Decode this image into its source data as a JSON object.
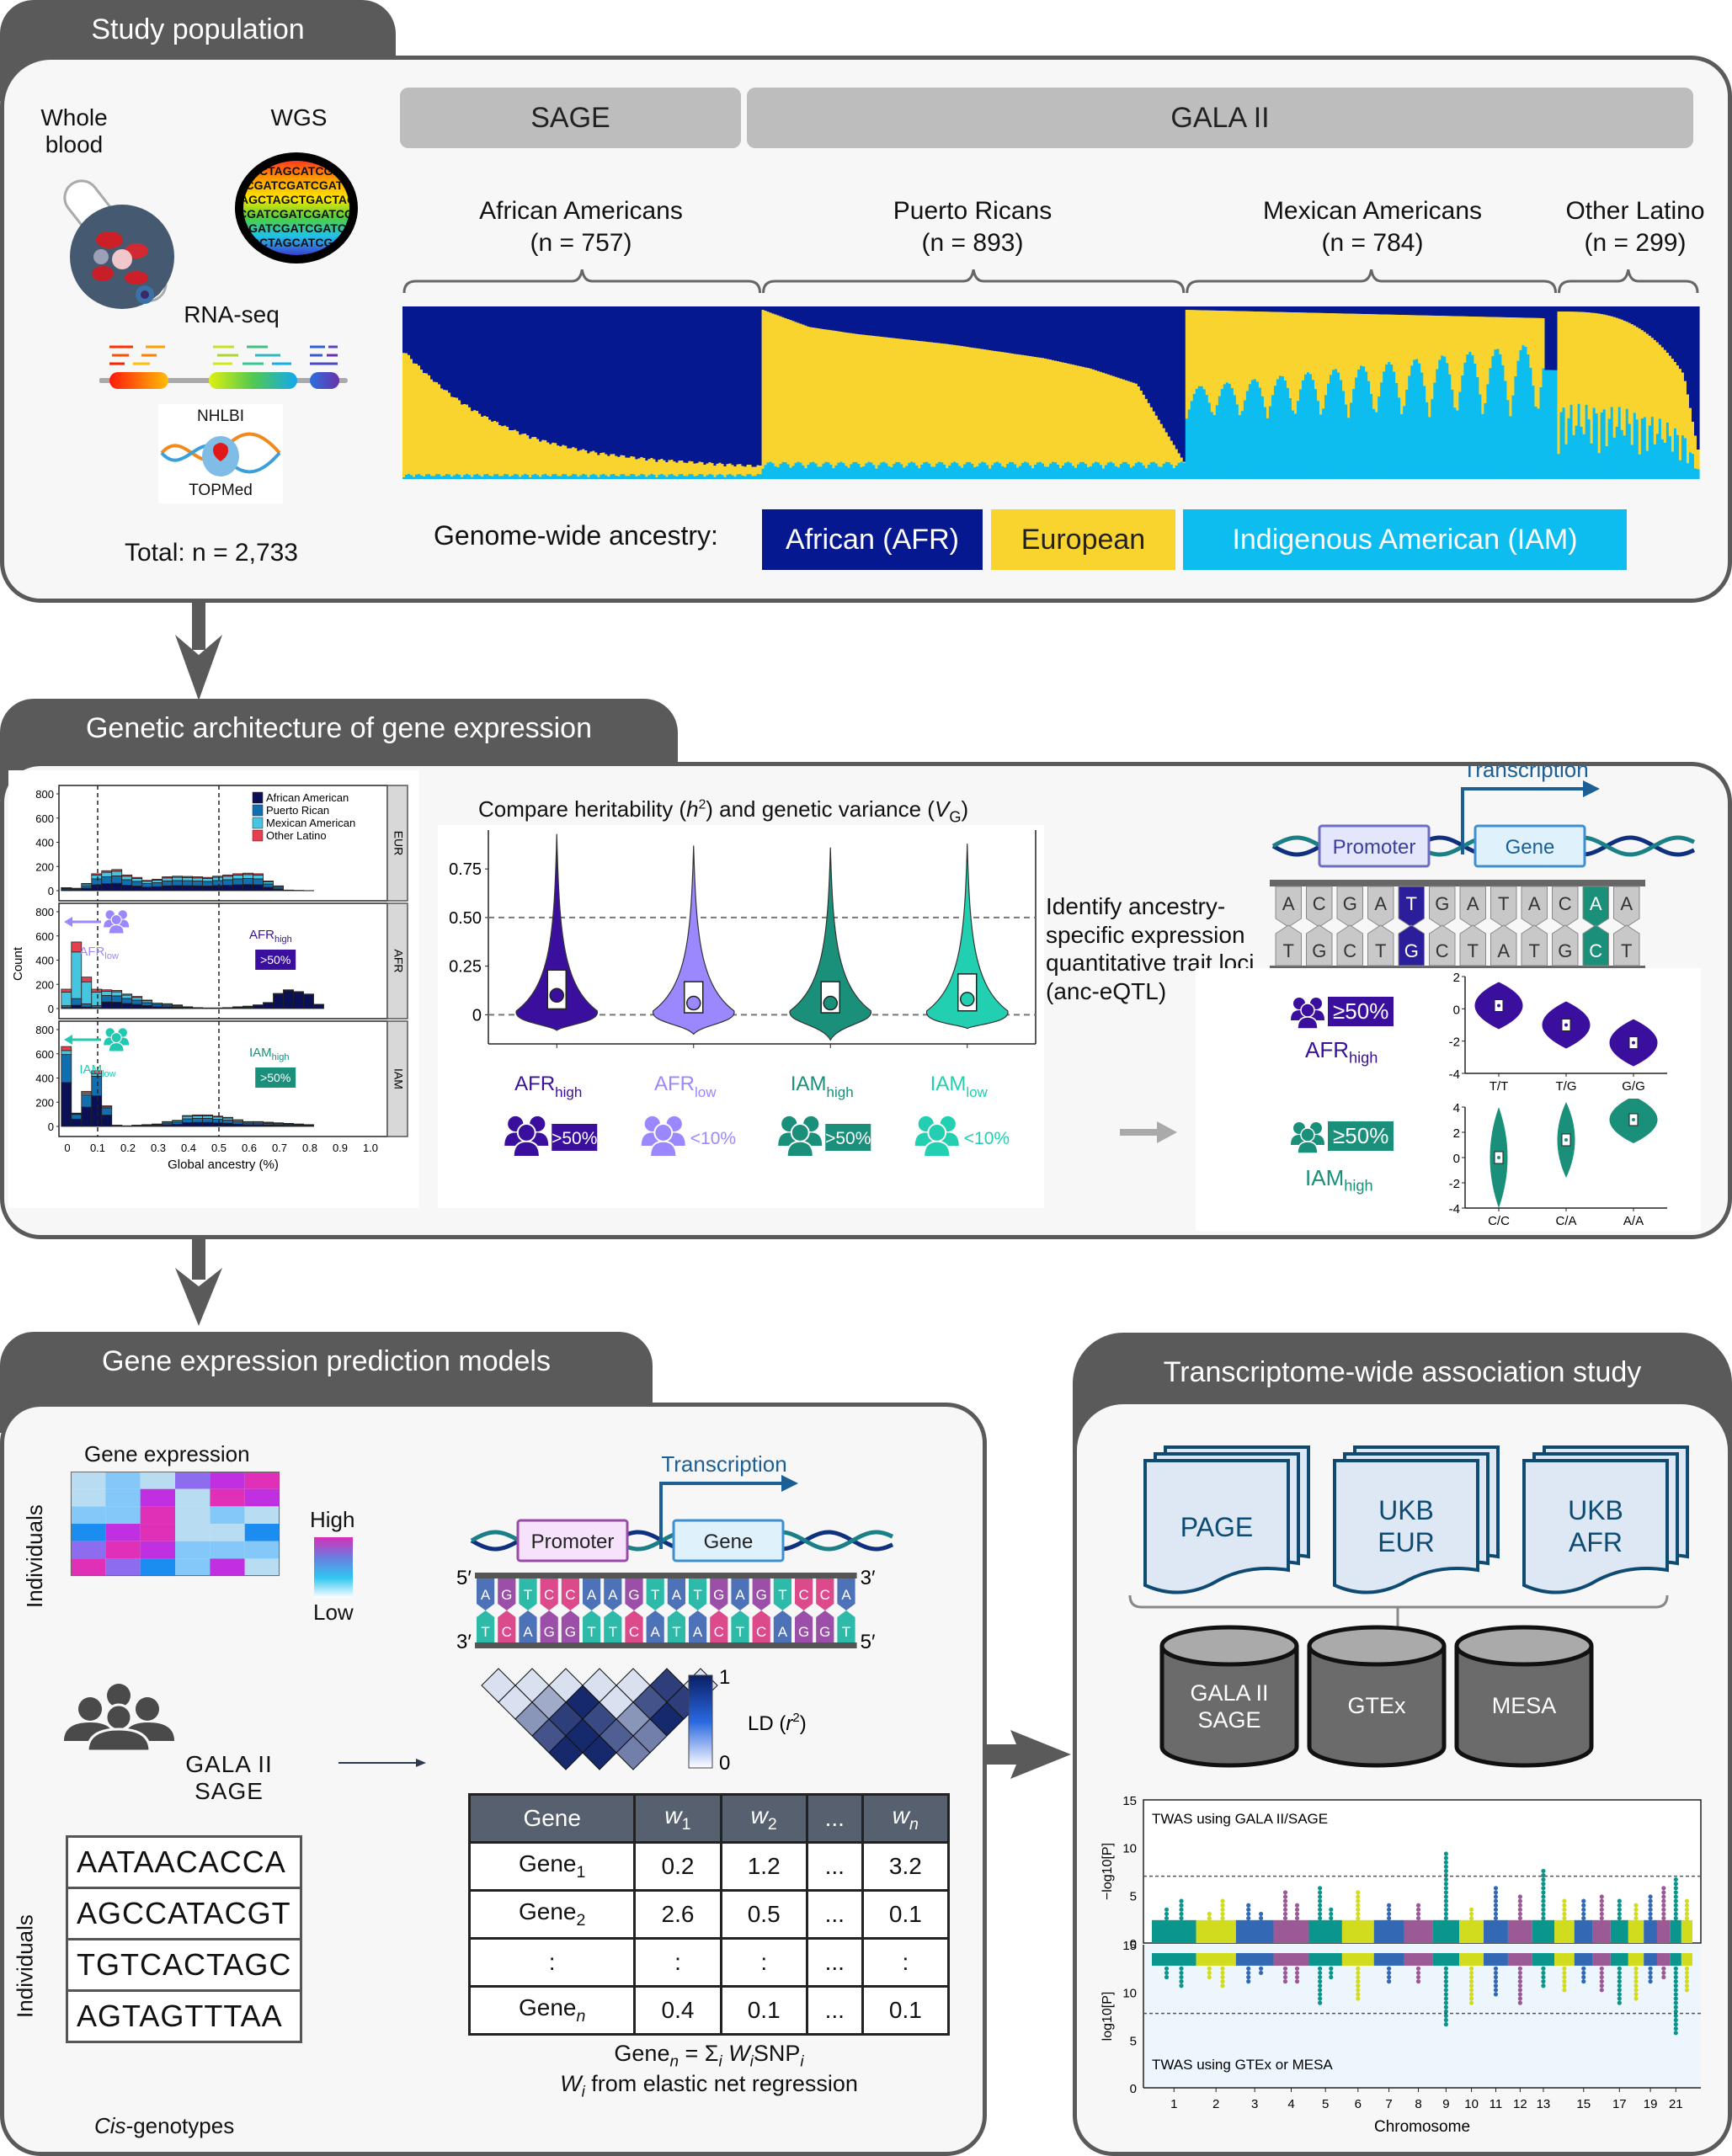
{
  "sections": {
    "study_population": {
      "title": "Study population",
      "whole_blood_label": "Whole\nblood",
      "wgs_label": "WGS",
      "rnaseq_label": "RNA-seq",
      "topmed_top": "NHLBI",
      "topmed_bottom": "TOPMed",
      "total_label": "Total: ",
      "total_n": "n = 2,733",
      "cohorts": [
        {
          "name": "SAGE"
        },
        {
          "name": "GALA II"
        }
      ],
      "groups": [
        {
          "name": "African Americans",
          "n_label": "(n = 757)",
          "n": 757
        },
        {
          "name": "Puerto Ricans",
          "n_label": "(n = 893)",
          "n": 893
        },
        {
          "name": "Mexican Americans",
          "n_label": "(n = 784)",
          "n": 784
        },
        {
          "name": "Other Latino",
          "n_label": "(n = 299)",
          "n": 299
        }
      ],
      "ancestry_legend_label": "Genome-wide ancestry:",
      "ancestry_legend": [
        {
          "label": "African (AFR)",
          "color": "#06188f",
          "text_color": "#ffffff"
        },
        {
          "label": "European",
          "color": "#f9d42f",
          "text_color": "#222222"
        },
        {
          "label": "Indigenous American (IAM)",
          "color": "#0dbdf0",
          "text_color": "#ffffff"
        }
      ]
    },
    "genetic_architecture": {
      "title": "Genetic architecture of gene expression",
      "heritability_title": "Compare heritability (h²) and genetic variance (V_G)",
      "eqtl_text": "Identify ancestry-specific expression quantitative trait loci (anc-eQTL)",
      "transcription_label": "Transcription",
      "promoter_label": "Promoter",
      "gene_label": "Gene",
      "dna_top": [
        "A",
        "C",
        "G",
        "A",
        "T",
        "G",
        "A",
        "T",
        "A",
        "C",
        "A",
        "A"
      ],
      "dna_bottom": [
        "T",
        "G",
        "C",
        "T",
        "G",
        "C",
        "T",
        "A",
        "T",
        "G",
        "C",
        "T"
      ],
      "afr_badge": "≥50%",
      "iam_badge": "≥50%",
      "afr_high_label": "AFR",
      "afr_high_sub": "high",
      "iam_high_label": "IAM",
      "iam_high_sub": "high"
    },
    "prediction_models": {
      "title": "Gene expression prediction models",
      "heatmap_title": "Gene expression",
      "individuals_label": "Individuals",
      "high_label": "High",
      "low_label": "Low",
      "cohort_label_1": "GALA II",
      "cohort_label_2": "SAGE",
      "genotypes": [
        "AATAACACCA",
        "AGCCATACGT",
        "TGTCACTAGC",
        "AGTAGTTTAA"
      ],
      "genotypes_caption_italic": "Cis",
      "genotypes_caption_rest": "-genotypes",
      "transcription_label": "Transcription",
      "promoter_label": "Promoter",
      "gene_label": "Gene",
      "five_prime": "5′",
      "three_prime": "3′",
      "dna_top": [
        "A",
        "G",
        "T",
        "C",
        "C",
        "A",
        "A",
        "G",
        "T",
        "A",
        "T",
        "G",
        "A",
        "G",
        "T",
        "C",
        "C",
        "A"
      ],
      "dna_bottom": [
        "T",
        "C",
        "A",
        "G",
        "G",
        "T",
        "T",
        "C",
        "A",
        "T",
        "A",
        "C",
        "T",
        "C",
        "A",
        "G",
        "G",
        "T"
      ],
      "ld_label": "LD (r²)",
      "ld_max": "1",
      "ld_min": "0",
      "weights_table": {
        "headers": [
          "Gene",
          "w1",
          "w2",
          "...",
          "wn"
        ],
        "rows": [
          [
            "Gene1",
            "0.2",
            "1.2",
            "...",
            "3.2"
          ],
          [
            "Gene2",
            "2.6",
            "0.5",
            "...",
            "0.1"
          ],
          [
            ":",
            ":",
            ":",
            "...",
            ":"
          ],
          [
            "Genen",
            "0.4",
            "0.1",
            "...",
            "0.1"
          ]
        ]
      },
      "formula_line1": "Gene_n = Σ_i W_i SNP_i",
      "formula_line2": "W_i from elastic net regression"
    },
    "twas": {
      "title": "Transcriptome-wide association study",
      "gwas_sources": [
        "PAGE",
        "UKB\nEUR",
        "UKB\nAFR"
      ],
      "models": [
        "GALA II\nSAGE",
        "GTEx",
        "MESA"
      ],
      "top_panel_label": "TWAS using GALA II/SAGE",
      "bottom_panel_label": "TWAS using GTEx or MESA",
      "top_ylabel": "−log10[P]",
      "bottom_ylabel": "log10[P]",
      "xlabel": "Chromosome"
    }
  },
  "chart_data": [
    {
      "id": "ancestry-stacked-bars",
      "type": "bar",
      "title": "Genome-wide ancestry",
      "stacked": true,
      "series_order": [
        "Indigenous American (IAM)",
        "European",
        "African (AFR)"
      ],
      "groups": [
        {
          "name": "African Americans",
          "n": 757,
          "afr_sorted_profile": [
            0.55,
            0.72,
            0.78,
            0.82,
            0.84,
            0.86,
            0.88,
            0.9,
            0.93,
            0.99
          ],
          "iam_mean": 0.01
        },
        {
          "name": "Puerto Ricans",
          "n": 893,
          "afr_sorted_profile": [
            0.02,
            0.12,
            0.16,
            0.19,
            0.22,
            0.26,
            0.3,
            0.36,
            0.45,
            0.9
          ],
          "iam_mean": 0.07
        },
        {
          "name": "Mexican Americans",
          "n": 784,
          "afr_sorted_profile": [
            0.0,
            0.01,
            0.02,
            0.03,
            0.03,
            0.04,
            0.04,
            0.05,
            0.06,
            0.1
          ],
          "iam_mean": 0.5
        },
        {
          "name": "Other Latino",
          "n": 299,
          "afr_sorted_profile": [
            0.01,
            0.05,
            0.1,
            0.16,
            0.22,
            0.3,
            0.4,
            0.5,
            0.62,
            0.8
          ],
          "iam_mean": 0.25
        }
      ],
      "ylim": [
        0,
        1
      ]
    },
    {
      "id": "global-ancestry-histograms",
      "type": "bar",
      "xlabel": "Global ancestry (%)",
      "ylabel": "Count",
      "x_ticks": [
        "0",
        "0.1",
        "0.2",
        "0.3",
        "0.4",
        "0.5",
        "0.6",
        "0.7",
        "0.8",
        "0.9",
        "1.0"
      ],
      "y_ticks": [
        "0",
        "200",
        "400",
        "600",
        "800"
      ],
      "ylim": [
        0,
        800
      ],
      "xlim": [
        0,
        1
      ],
      "reference_lines_x": [
        0.1,
        0.5
      ],
      "legend": [
        {
          "name": "African American",
          "color": "#0b0f55"
        },
        {
          "name": "Puerto Rican",
          "color": "#0f6fb0"
        },
        {
          "name": "Mexican American",
          "color": "#45c6e0"
        },
        {
          "name": "Other Latino",
          "color": "#e6404f"
        }
      ],
      "legend_position": "top-right",
      "bin_width": 0.0333,
      "facets": [
        {
          "label": "EUR",
          "totals": [
            25,
            20,
            60,
            140,
            165,
            175,
            130,
            110,
            85,
            95,
            115,
            120,
            118,
            115,
            110,
            120,
            130,
            140,
            145,
            140,
            80,
            40,
            5,
            2,
            1
          ],
          "annotations": []
        },
        {
          "label": "AFR",
          "totals": [
            160,
            550,
            260,
            160,
            155,
            150,
            120,
            100,
            70,
            45,
            40,
            30,
            15,
            8,
            5,
            5,
            8,
            15,
            20,
            30,
            50,
            125,
            155,
            140,
            120,
            35
          ],
          "annotations": [
            {
              "text": "AFR",
              "sub": "low",
              "color": "#9b88ff"
            },
            {
              "text": "AFR",
              "sub": "high",
              "color": "#3a0f9e",
              "badge": ">50%"
            }
          ]
        },
        {
          "label": "IAM",
          "totals": [
            660,
            110,
            290,
            460,
            170,
            10,
            5,
            10,
            15,
            20,
            40,
            50,
            90,
            95,
            95,
            85,
            75,
            55,
            40,
            40,
            35,
            30,
            25,
            20,
            15
          ],
          "annotations": [
            {
              "text": "IAM",
              "sub": "low",
              "color": "#22c9b0"
            },
            {
              "text": "IAM",
              "sub": "high",
              "color": "#1a8f7a",
              "badge": ">50%"
            }
          ]
        }
      ]
    },
    {
      "id": "heritability-violins",
      "type": "violin",
      "title": "Compare heritability (h²) and genetic variance (V_G)",
      "y_ticks": [
        "0",
        "0.25",
        "0.50",
        "0.75"
      ],
      "ylim": [
        -0.15,
        0.95
      ],
      "reference_lines_y": [
        0,
        0.5
      ],
      "groups": [
        {
          "label": "AFR",
          "sub": "high",
          "badge": ">50%",
          "color": "#3a0f9e",
          "median": 0.1,
          "q1": 0.03,
          "q3": 0.23,
          "max": 0.93,
          "min": -0.08
        },
        {
          "label": "AFR",
          "sub": "low",
          "badge": "<10%",
          "color": "#9b88ff",
          "median": 0.06,
          "q1": 0.01,
          "q3": 0.17,
          "max": 0.87,
          "min": -0.1
        },
        {
          "label": "IAM",
          "sub": "high",
          "badge": ">50%",
          "color": "#1a8f7a",
          "median": 0.06,
          "q1": 0.01,
          "q3": 0.17,
          "max": 0.86,
          "min": -0.13
        },
        {
          "label": "IAM",
          "sub": "low",
          "badge": "<10%",
          "color": "#22cfb0",
          "median": 0.08,
          "q1": 0.02,
          "q3": 0.21,
          "max": 0.88,
          "min": -0.07
        }
      ]
    },
    {
      "id": "eqtl-afr-violins",
      "type": "violin",
      "y_ticks": [
        "-4",
        "-2",
        "0",
        "2"
      ],
      "ylim": [
        -4,
        2
      ],
      "color": "#3a0f9e",
      "categories": [
        "T/T",
        "T/G",
        "G/G"
      ],
      "medians": [
        0.2,
        -1.0,
        -2.1
      ]
    },
    {
      "id": "eqtl-iam-violins",
      "type": "violin",
      "y_ticks": [
        "-4",
        "-2",
        "0",
        "2",
        "4"
      ],
      "ylim": [
        -4,
        4
      ],
      "color": "#1a8f7a",
      "categories": [
        "C/C",
        "C/A",
        "A/A"
      ],
      "medians": [
        0.0,
        1.4,
        3.0
      ]
    },
    {
      "id": "expression-heatmap",
      "type": "heatmap",
      "title": "Gene expression",
      "ylabel": "Individuals",
      "scale": [
        "Low",
        "High"
      ],
      "values": [
        [
          0.1,
          0.25,
          0.1,
          0.6,
          0.85,
          0.95
        ],
        [
          0.1,
          0.25,
          0.8,
          0.1,
          0.95,
          0.85
        ],
        [
          0.25,
          0.25,
          0.95,
          0.1,
          0.25,
          0.1
        ],
        [
          0.4,
          0.85,
          0.95,
          0.1,
          0.1,
          0.4
        ],
        [
          0.6,
          0.95,
          0.85,
          0.25,
          0.25,
          0.25
        ],
        [
          0.95,
          0.6,
          0.4,
          0.25,
          0.85,
          0.1
        ]
      ]
    },
    {
      "id": "ld-triangle",
      "type": "heatmap",
      "title": "LD (r²)",
      "scale": [
        "0",
        "1"
      ],
      "rows": [
        [
          0.1,
          0.1,
          0.1,
          0.1,
          0.1,
          0.85,
          0.1
        ],
        [
          0.1,
          0.35,
          0.95,
          0.1,
          0.75,
          0.85
        ],
        [
          0.45,
          0.85,
          0.8,
          0.45,
          0.95
        ],
        [
          0.75,
          0.95,
          0.7,
          0.55
        ],
        [
          0.95,
          0.95,
          0.55
        ]
      ]
    },
    {
      "id": "twas-manhattan",
      "type": "scatter",
      "xlabel": "Chromosome",
      "x_ticks": [
        "1",
        "2",
        "3",
        "4",
        "5",
        "6",
        "7",
        "8",
        "9",
        "10",
        "11",
        "12",
        "13",
        "15",
        "17",
        "19",
        "21"
      ],
      "chromosomes": [
        1,
        2,
        3,
        4,
        5,
        6,
        7,
        8,
        9,
        10,
        11,
        12,
        13,
        14,
        15,
        16,
        17,
        18,
        19,
        20,
        21,
        22
      ],
      "chrom_colors": [
        "#0a968c",
        "#d2dc1e",
        "#3369b4",
        "#9b5a96"
      ],
      "panels": [
        {
          "label": "TWAS using GALA II/SAGE",
          "ylabel": "−log10[P]",
          "y_ticks": [
            "0",
            "5",
            "10",
            "15"
          ],
          "ylim": [
            0,
            15
          ],
          "threshold": 7.0,
          "peaks": [
            3.7,
            4.6,
            3.5,
            4.6,
            4.0,
            3.2,
            5.7,
            4.2,
            6.2,
            3.6,
            5.5,
            4.0,
            4.3,
            9.6,
            3.6,
            6.2,
            5.2,
            7.8,
            4.4,
            4.4,
            4.9,
            4.7,
            4.3,
            4.9,
            6.2,
            6.7,
            4.4,
            3.6,
            10.0,
            4.9,
            4.3,
            5.7,
            4.3,
            3.3,
            6.6,
            4.4,
            6.0,
            4.6,
            3.3
          ]
        },
        {
          "label": "TWAS using GTEx or MESA",
          "ylabel": "log10[P]",
          "y_ticks": [
            "0",
            "5",
            "10",
            "15"
          ],
          "ylim": [
            0,
            15
          ],
          "threshold": 7.8,
          "inverted": true,
          "troughs": [
            11.3,
            10.3,
            11.5,
            10.3,
            10.9,
            11.7,
            11.0,
            10.9,
            8.7,
            11.2,
            9.3,
            11.0,
            10.8,
            6.4,
            8.7,
            9.7,
            8.9,
            10.6,
            10.0,
            10.8,
            10.1,
            8.7,
            9.3,
            10.8,
            11.2,
            5.7,
            10.1,
            10.8,
            9.2,
            10.5,
            11.5,
            9.3,
            10.9,
            9.3,
            10.3,
            11.6
          ]
        }
      ]
    }
  ]
}
